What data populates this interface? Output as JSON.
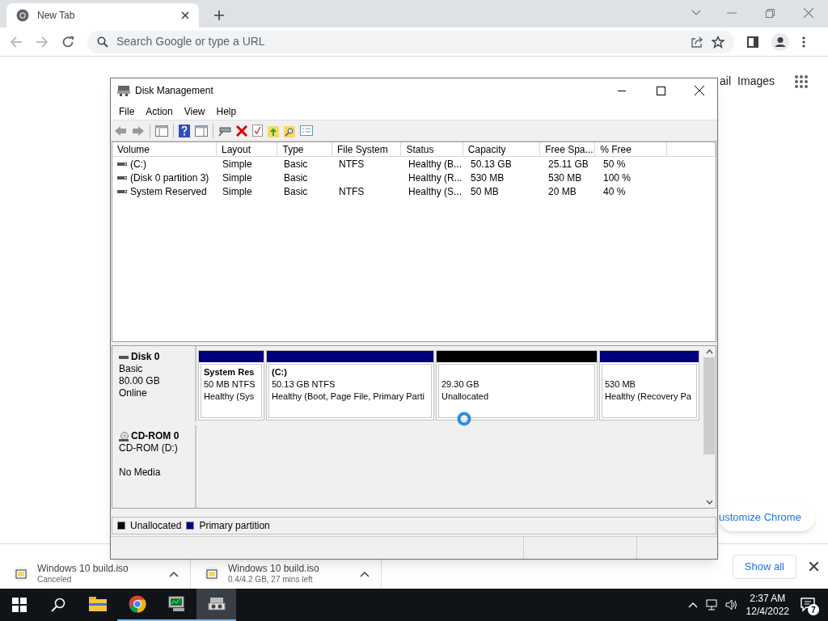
{
  "browser": {
    "tab": {
      "title": "New Tab"
    },
    "omnibox": {
      "placeholder": "Search Google or type a URL"
    },
    "page_links": [
      "ail",
      "Images"
    ],
    "customize": "ustomize Chrome"
  },
  "disk_management": {
    "title": "Disk Management",
    "menu": [
      "File",
      "Action",
      "View",
      "Help"
    ],
    "columns": [
      "Volume",
      "Layout",
      "Type",
      "File System",
      "Status",
      "Capacity",
      "Free Spa...",
      "% Free"
    ],
    "rows": [
      {
        "cells": [
          "(C:)",
          "Simple",
          "Basic",
          "NTFS",
          "Healthy (B...",
          "50.13 GB",
          "25.11 GB",
          "50 %"
        ]
      },
      {
        "cells": [
          "(Disk 0 partition 3)",
          "Simple",
          "Basic",
          "",
          "Healthy (R...",
          "530 MB",
          "530 MB",
          "100 %"
        ]
      },
      {
        "cells": [
          "System Reserved",
          "Simple",
          "Basic",
          "NTFS",
          "Healthy (S...",
          "50 MB",
          "20 MB",
          "40 %"
        ]
      }
    ],
    "disks": [
      {
        "kind": "disk",
        "name": "Disk 0",
        "type": "Basic",
        "size": "80.00 GB",
        "status": "Online",
        "partitions": [
          {
            "title": "System Res",
            "size": "50 MB NTFS",
            "status": "Healthy (Sys",
            "color": "#00007f"
          },
          {
            "title": "(C:)",
            "size": "50.13 GB NTFS",
            "status": "Healthy (Boot, Page File, Primary Parti",
            "color": "#00007f"
          },
          {
            "size": "29.30 GB",
            "status": "Unallocated",
            "color": "#000000"
          },
          {
            "size": "530 MB",
            "status": "Healthy (Recovery Pa",
            "color": "#00007f"
          }
        ]
      },
      {
        "kind": "cdrom",
        "name": "CD-ROM 0",
        "type": "CD-ROM (D:)",
        "status": "No Media"
      }
    ],
    "legend": [
      {
        "label": "Unallocated",
        "color": "#000000"
      },
      {
        "label": "Primary partition",
        "color": "#00007f"
      }
    ]
  },
  "downloads": [
    {
      "name": "Windows 10 build.iso",
      "status": "Canceled"
    },
    {
      "name": "Windows 10 build.iso",
      "status": "0.4/4.2 GB, 27 mins left"
    }
  ],
  "show_all": "Show all",
  "taskbar": {
    "apps": [
      {
        "kind": "explorer",
        "running": false,
        "selected": false
      },
      {
        "kind": "chrome",
        "running": true,
        "selected": false
      },
      {
        "kind": "monitor",
        "running": true,
        "selected": false
      },
      {
        "kind": "diskmgmt",
        "running": true,
        "selected": true
      }
    ],
    "time": "2:37 AM",
    "date": "12/4/2022",
    "notifications": "7"
  }
}
